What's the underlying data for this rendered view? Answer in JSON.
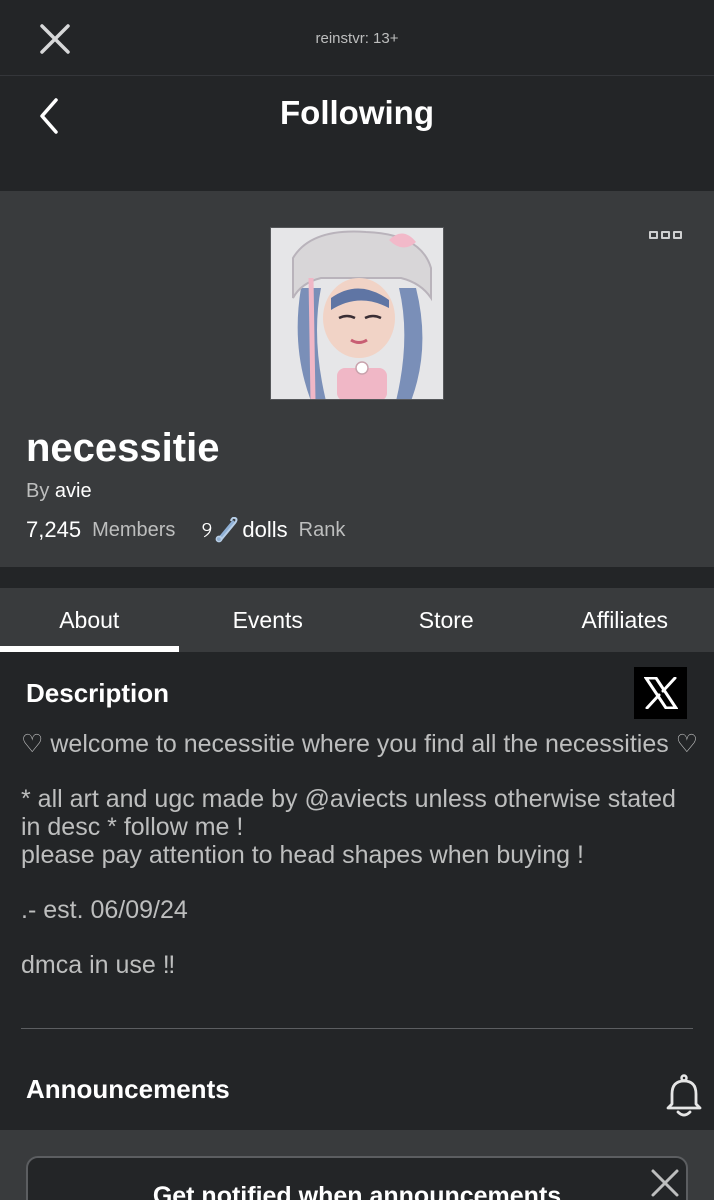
{
  "top_bar": {
    "title": "reinstvr: 13+",
    "close_icon": "close-icon"
  },
  "nav": {
    "title": "Following",
    "back_icon": "chevron-left-icon"
  },
  "group": {
    "name": "necessitie",
    "by_label": "By",
    "owner": "avie",
    "members_count": "7,245",
    "members_label": "Members",
    "rank_prefix": "୨",
    "rank_name": "dolls",
    "rank_label": "Rank",
    "more_icon": "more-options-icon",
    "icon_name": "group-avatar-image"
  },
  "tabs": [
    {
      "label": "About",
      "active": true
    },
    {
      "label": "Events",
      "active": false
    },
    {
      "label": "Store",
      "active": false
    },
    {
      "label": "Affiliates",
      "active": false
    }
  ],
  "about": {
    "description_title": "Description",
    "social_icon": "x-logo-icon",
    "description_lines": [
      "♡ welcome to necessitie where you find all the necessities ♡",
      "* all art and ugc made by @aviects unless otherwise stated in desc * follow me !\nplease pay attention to head shapes when buying !",
      ".- est. 06/09/24",
      "dmca in use ‼"
    ],
    "announcements_title": "Announcements",
    "bell_icon": "bell-icon"
  },
  "notify": {
    "text": "Get notified when announcements",
    "close_icon": "close-icon"
  },
  "colors": {
    "background": "#232527",
    "panel": "#393b3d",
    "text": "#ffffff",
    "muted": "#bdbebe"
  }
}
